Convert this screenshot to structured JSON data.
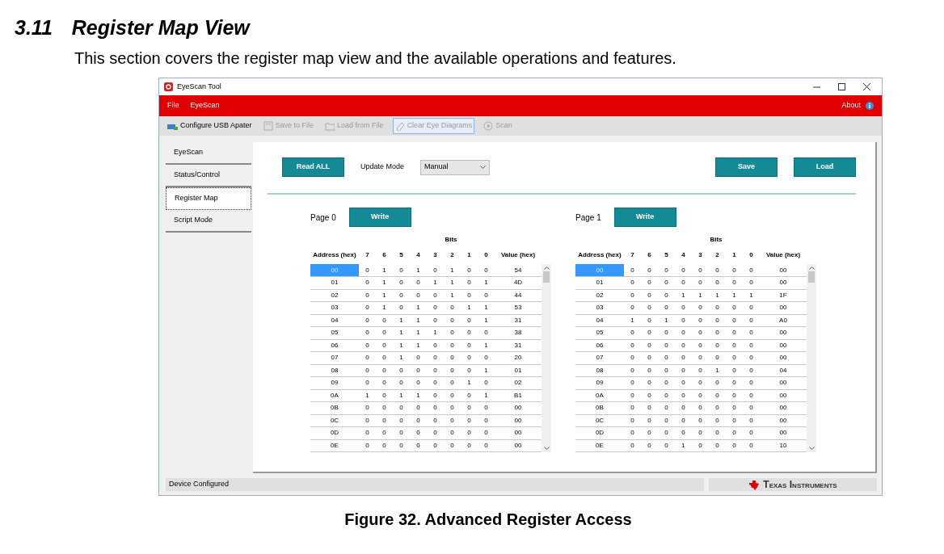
{
  "section": {
    "number": "3.11",
    "title": "Register Map View",
    "intro": "This section covers the register map view and the available operations and features."
  },
  "window": {
    "title": "EyeScan Tool"
  },
  "menu": [
    {
      "label": "File"
    },
    {
      "label": "EyeScan"
    }
  ],
  "about": "About",
  "toolbar": [
    {
      "label": "Configure USB Apater",
      "kind": "usb",
      "disabled": false,
      "highlighted": false
    },
    {
      "label": "Save to File",
      "kind": "save",
      "disabled": true,
      "highlighted": false
    },
    {
      "label": "Load from File",
      "kind": "folder",
      "disabled": true,
      "highlighted": false
    },
    {
      "label": "Clear Eye Diagrams",
      "kind": "eraser",
      "disabled": true,
      "highlighted": true
    },
    {
      "label": "Scan",
      "kind": "play",
      "disabled": true,
      "highlighted": false
    }
  ],
  "sidebar": [
    {
      "label": "EyeScan",
      "selected": false
    },
    {
      "label": "Status/Control",
      "selected": false
    },
    {
      "label": "Register Map",
      "selected": true
    },
    {
      "label": "Script Mode",
      "selected": false
    }
  ],
  "controls": {
    "read_all": "Read ALL",
    "update_mode_label": "Update Mode",
    "update_mode": "Manual",
    "save": "Save",
    "load": "Load"
  },
  "pages": [
    {
      "label": "Page 0",
      "write": "Write",
      "group_header": "Bits",
      "columns": [
        "Address (hex)",
        "7",
        "6",
        "5",
        "4",
        "3",
        "2",
        "1",
        "0",
        "Value (hex)"
      ],
      "rows": [
        {
          "address": "00",
          "bits": [
            "0",
            "1",
            "0",
            "1",
            "0",
            "1",
            "0",
            "0"
          ],
          "value": "54",
          "selected": true
        },
        {
          "address": "01",
          "bits": [
            "0",
            "1",
            "0",
            "0",
            "1",
            "1",
            "0",
            "1"
          ],
          "value": "4D",
          "selected": false
        },
        {
          "address": "02",
          "bits": [
            "0",
            "1",
            "0",
            "0",
            "0",
            "1",
            "0",
            "0"
          ],
          "value": "44",
          "selected": false
        },
        {
          "address": "03",
          "bits": [
            "0",
            "1",
            "0",
            "1",
            "0",
            "0",
            "1",
            "1"
          ],
          "value": "53",
          "selected": false
        },
        {
          "address": "04",
          "bits": [
            "0",
            "0",
            "1",
            "1",
            "0",
            "0",
            "0",
            "1"
          ],
          "value": "31",
          "selected": false
        },
        {
          "address": "05",
          "bits": [
            "0",
            "0",
            "1",
            "1",
            "1",
            "0",
            "0",
            "0"
          ],
          "value": "38",
          "selected": false
        },
        {
          "address": "06",
          "bits": [
            "0",
            "0",
            "1",
            "1",
            "0",
            "0",
            "0",
            "1"
          ],
          "value": "31",
          "selected": false
        },
        {
          "address": "07",
          "bits": [
            "0",
            "0",
            "1",
            "0",
            "0",
            "0",
            "0",
            "0"
          ],
          "value": "20",
          "selected": false
        },
        {
          "address": "08",
          "bits": [
            "0",
            "0",
            "0",
            "0",
            "0",
            "0",
            "0",
            "1"
          ],
          "value": "01",
          "selected": false
        },
        {
          "address": "09",
          "bits": [
            "0",
            "0",
            "0",
            "0",
            "0",
            "0",
            "1",
            "0"
          ],
          "value": "02",
          "selected": false
        },
        {
          "address": "0A",
          "bits": [
            "1",
            "0",
            "1",
            "1",
            "0",
            "0",
            "0",
            "1"
          ],
          "value": "B1",
          "selected": false
        },
        {
          "address": "0B",
          "bits": [
            "0",
            "0",
            "0",
            "0",
            "0",
            "0",
            "0",
            "0"
          ],
          "value": "00",
          "selected": false
        },
        {
          "address": "0C",
          "bits": [
            "0",
            "0",
            "0",
            "0",
            "0",
            "0",
            "0",
            "0"
          ],
          "value": "00",
          "selected": false
        },
        {
          "address": "0D",
          "bits": [
            "0",
            "0",
            "0",
            "0",
            "0",
            "0",
            "0",
            "0"
          ],
          "value": "00",
          "selected": false
        },
        {
          "address": "0E",
          "bits": [
            "0",
            "0",
            "0",
            "0",
            "0",
            "0",
            "0",
            "0"
          ],
          "value": "00",
          "selected": false
        }
      ]
    },
    {
      "label": "Page 1",
      "write": "Write",
      "group_header": "Bits",
      "columns": [
        "Address (hex)",
        "7",
        "6",
        "5",
        "4",
        "3",
        "2",
        "1",
        "0",
        "Value (hex)"
      ],
      "rows": [
        {
          "address": "00",
          "bits": [
            "0",
            "0",
            "0",
            "0",
            "0",
            "0",
            "0",
            "0"
          ],
          "value": "00",
          "selected": true
        },
        {
          "address": "01",
          "bits": [
            "0",
            "0",
            "0",
            "0",
            "0",
            "0",
            "0",
            "0"
          ],
          "value": "00",
          "selected": false
        },
        {
          "address": "02",
          "bits": [
            "0",
            "0",
            "0",
            "1",
            "1",
            "1",
            "1",
            "1"
          ],
          "value": "1F",
          "selected": false
        },
        {
          "address": "03",
          "bits": [
            "0",
            "0",
            "0",
            "0",
            "0",
            "0",
            "0",
            "0"
          ],
          "value": "00",
          "selected": false
        },
        {
          "address": "04",
          "bits": [
            "1",
            "0",
            "1",
            "0",
            "0",
            "0",
            "0",
            "0"
          ],
          "value": "A0",
          "selected": false
        },
        {
          "address": "05",
          "bits": [
            "0",
            "0",
            "0",
            "0",
            "0",
            "0",
            "0",
            "0"
          ],
          "value": "00",
          "selected": false
        },
        {
          "address": "06",
          "bits": [
            "0",
            "0",
            "0",
            "0",
            "0",
            "0",
            "0",
            "0"
          ],
          "value": "00",
          "selected": false
        },
        {
          "address": "07",
          "bits": [
            "0",
            "0",
            "0",
            "0",
            "0",
            "0",
            "0",
            "0"
          ],
          "value": "00",
          "selected": false
        },
        {
          "address": "08",
          "bits": [
            "0",
            "0",
            "0",
            "0",
            "0",
            "1",
            "0",
            "0"
          ],
          "value": "04",
          "selected": false
        },
        {
          "address": "09",
          "bits": [
            "0",
            "0",
            "0",
            "0",
            "0",
            "0",
            "0",
            "0"
          ],
          "value": "00",
          "selected": false
        },
        {
          "address": "0A",
          "bits": [
            "0",
            "0",
            "0",
            "0",
            "0",
            "0",
            "0",
            "0"
          ],
          "value": "00",
          "selected": false
        },
        {
          "address": "0B",
          "bits": [
            "0",
            "0",
            "0",
            "0",
            "0",
            "0",
            "0",
            "0"
          ],
          "value": "00",
          "selected": false
        },
        {
          "address": "0C",
          "bits": [
            "0",
            "0",
            "0",
            "0",
            "0",
            "0",
            "0",
            "0"
          ],
          "value": "00",
          "selected": false
        },
        {
          "address": "0D",
          "bits": [
            "0",
            "0",
            "0",
            "0",
            "0",
            "0",
            "0",
            "0"
          ],
          "value": "00",
          "selected": false
        },
        {
          "address": "0E",
          "bits": [
            "0",
            "0",
            "0",
            "1",
            "0",
            "0",
            "0",
            "0"
          ],
          "value": "10",
          "selected": false
        }
      ]
    }
  ],
  "status": "Device Configured",
  "logo": "Texas Instruments",
  "caption": "Figure 32. Advanced Register Access"
}
